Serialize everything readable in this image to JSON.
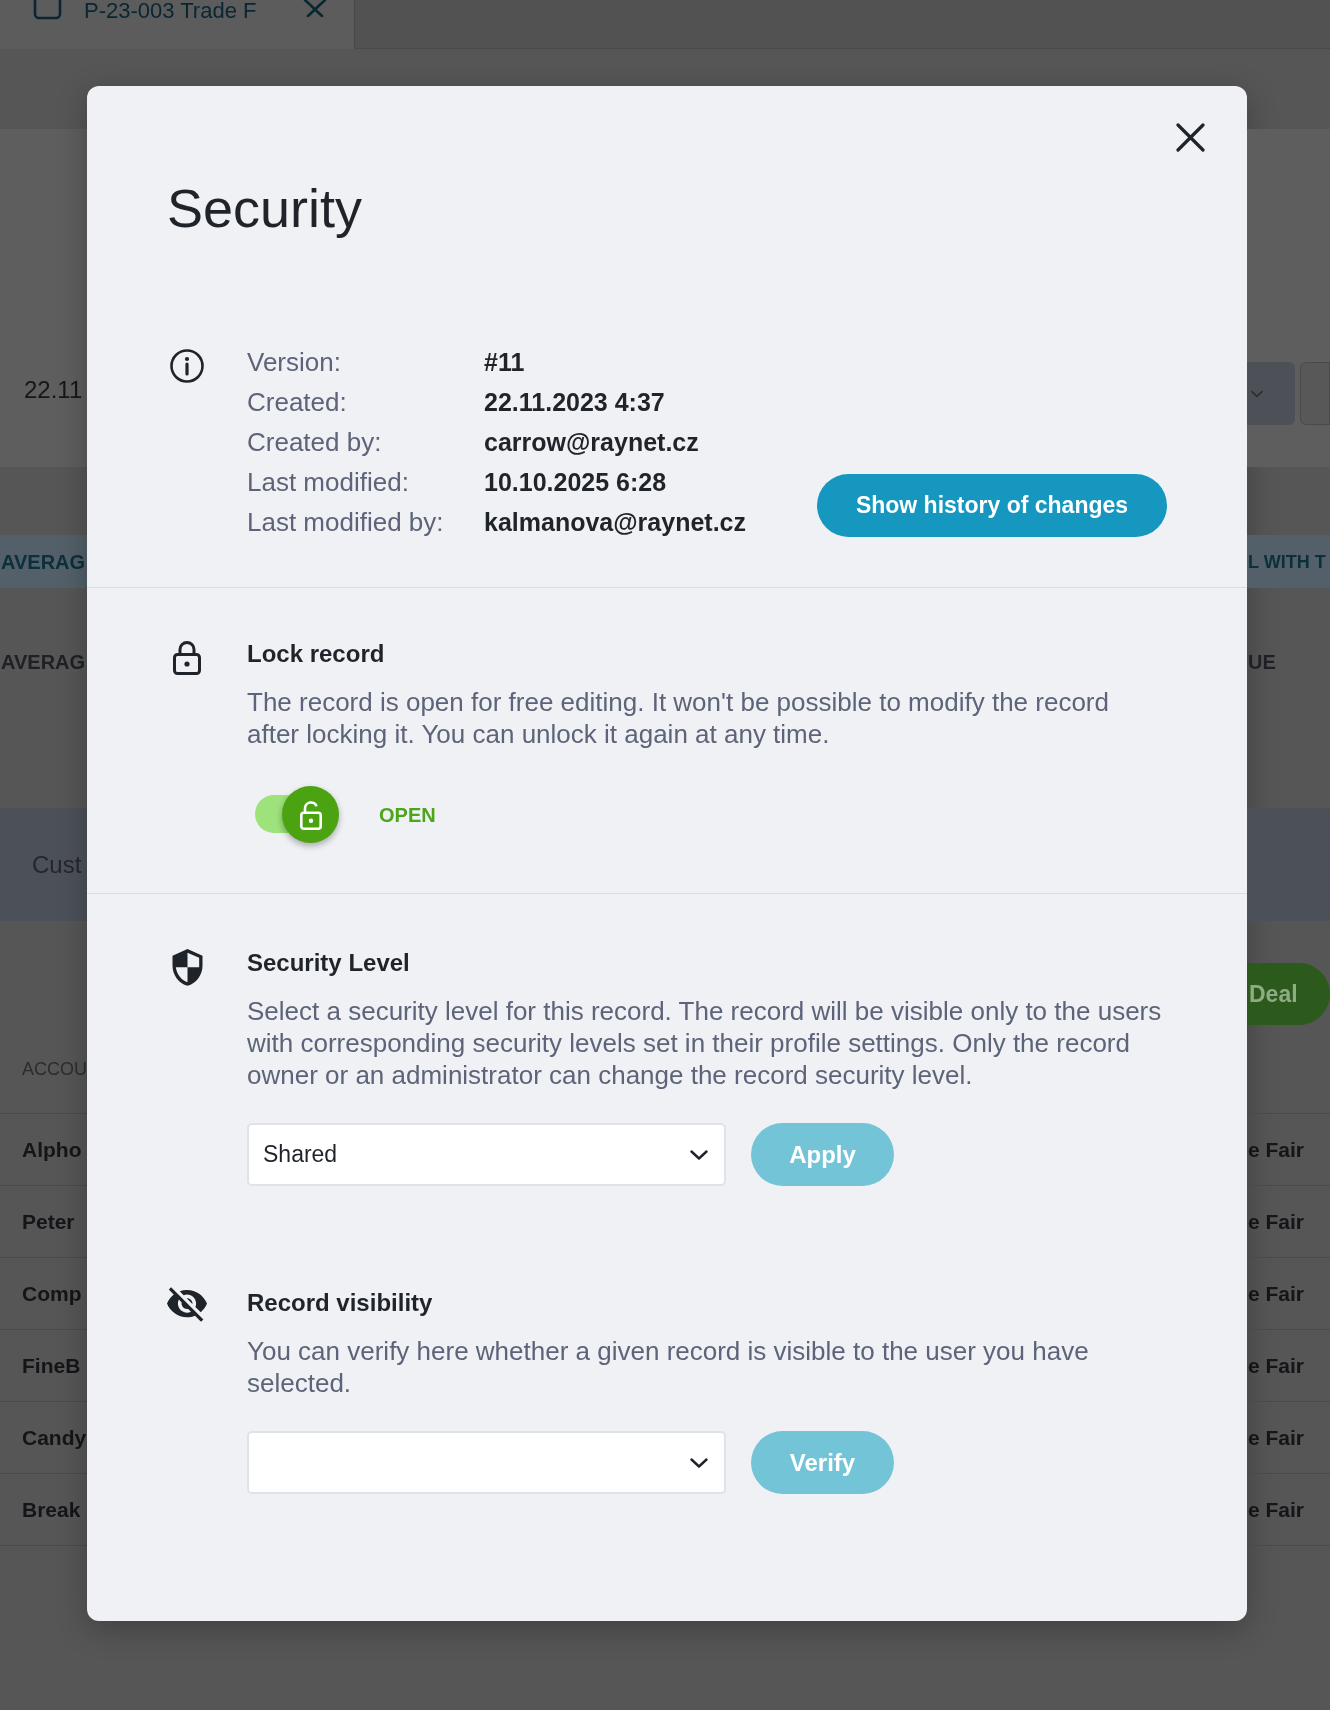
{
  "background": {
    "tab": {
      "label": "P-23-003 Trade F"
    },
    "date_field": "22.11",
    "summary_headers": [
      "AVERAG",
      "L WITH T"
    ],
    "summary_labels": [
      "AVERAG",
      "UE"
    ],
    "section_title": "Cust",
    "deal_button": {
      "label": "Deal"
    },
    "table": {
      "columns": [
        "ACCOU"
      ],
      "rows": [
        {
          "column_1": "Alpho",
          "column_2": "e Fair"
        },
        {
          "column_1": "Peter",
          "column_2": "e Fair"
        },
        {
          "column_1": "Comp",
          "column_2": "e Fair"
        },
        {
          "column_1": "FineB",
          "column_2": "e Fair"
        },
        {
          "column_1": "Candy",
          "column_2": "e Fair"
        },
        {
          "column_1": "Break",
          "column_2": "e Fair"
        }
      ]
    }
  },
  "dialog": {
    "title": "Security",
    "info": {
      "rows": [
        {
          "label": "Version:",
          "value": "#11"
        },
        {
          "label": "Created:",
          "value": "22.11.2023 4:37"
        },
        {
          "label": "Created by:",
          "value": "carrow@raynet.cz"
        },
        {
          "label": "Last modified:",
          "value": "10.10.2025 6:28"
        },
        {
          "label": "Last modified by:",
          "value": "kalmanova@raynet.cz"
        }
      ],
      "history_button": {
        "label": "Show history of changes",
        "disabled": false
      }
    },
    "sections": [
      {
        "kind": "lock",
        "title": "Lock record",
        "description": "The record is open for free editing. It won't be possible to modify the record after locking it. You can unlock it again at any time.",
        "toggle": {
          "locked": false,
          "status": "OPEN"
        }
      },
      {
        "kind": "level",
        "title": "Security Level",
        "description": "Select a security level for this record. The record will be visible only to the users with corresponding security levels set in their profile settings. Only the record owner or an administrator can change the record security level.",
        "select": {
          "value": "Shared"
        },
        "button": {
          "label": "Apply",
          "disabled": true
        }
      },
      {
        "kind": "visibility",
        "title": "Record visibility",
        "description": "You can verify here whether a given record is visible to the user you have selected.",
        "button": {
          "label": "Verify",
          "disabled": true
        }
      }
    ]
  }
}
